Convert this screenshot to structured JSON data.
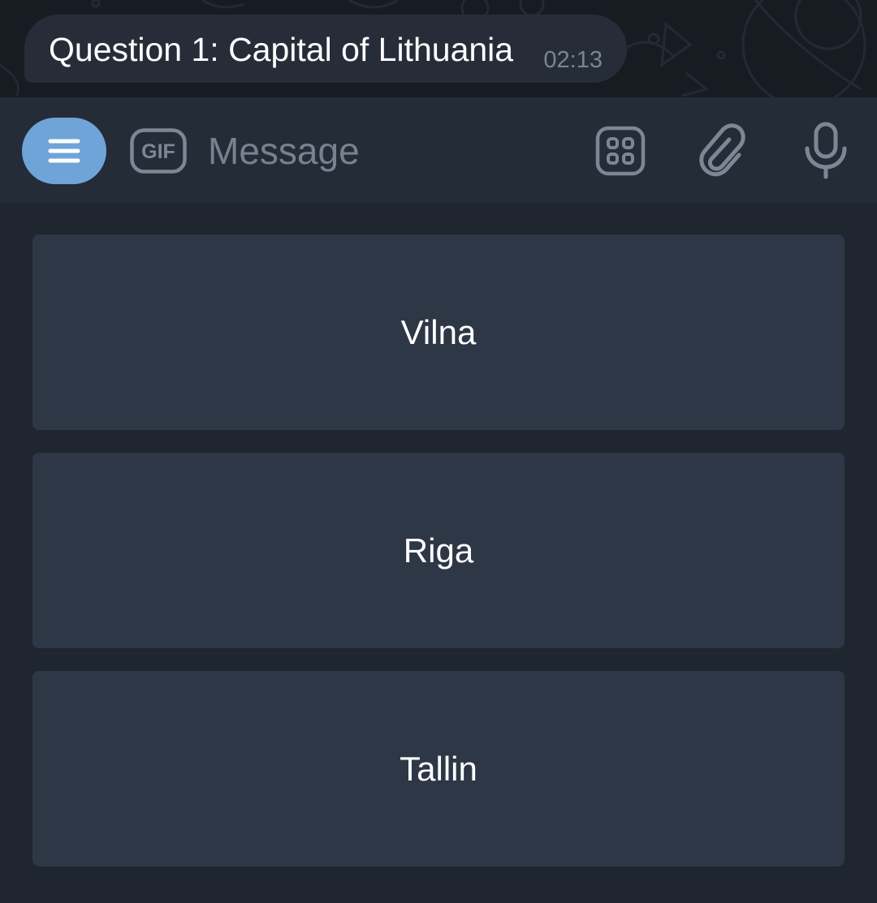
{
  "message": {
    "text": "Question 1: Capital of Lithuania",
    "time": "02:13"
  },
  "composer": {
    "placeholder": "Message",
    "gif_label": "GIF",
    "icons": [
      "menu-icon",
      "gif-icon",
      "sticker-icon",
      "attach-icon",
      "mic-icon"
    ]
  },
  "keyboard": {
    "buttons": [
      {
        "label": "Vilna"
      },
      {
        "label": "Riga"
      },
      {
        "label": "Tallin"
      }
    ]
  },
  "colors": {
    "accent": "#6ea4d8",
    "bubble": "#262d38",
    "button": "#2e3746",
    "panel": "#242c37"
  }
}
